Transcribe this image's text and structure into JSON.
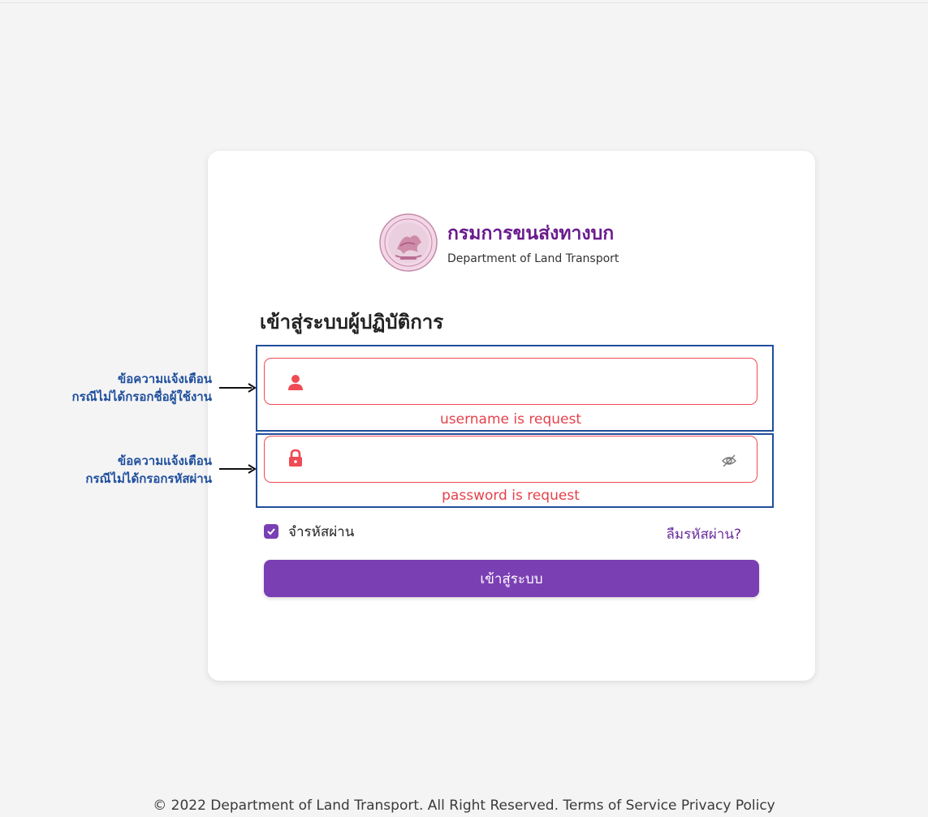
{
  "header": {
    "org_name_th": "กรมการขนส่งทางบก",
    "org_name_en": "Department of Land Transport"
  },
  "login": {
    "title": "เข้าสู่ระบบผู้ปฏิบัติการ",
    "username": {
      "value": "",
      "placeholder": "",
      "error": "username is request",
      "icon": "user-icon"
    },
    "password": {
      "value": "",
      "placeholder": "",
      "error": "password is request",
      "icon": "lock-icon",
      "toggle_icon": "eye-slash-icon"
    },
    "remember_label": "จำรหัสผ่าน",
    "remember_checked": true,
    "forgot_label": "ลืมรหัสผ่าน?",
    "submit_label": "เข้าสู่ระบบ"
  },
  "annotations": {
    "username_line1": "ข้อความแจ้งเตือน",
    "username_line2": "กรณีไม่ได้กรอกชื่อผู้ใช้งาน",
    "password_line1": "ข้อความแจ้งเตือน",
    "password_line2": "กรณีไม่ได้กรอกรหัสผ่าน"
  },
  "footer": {
    "copyright": "© 2022 Department of Land Transport. All Right Reserved.",
    "terms": "Terms of Service",
    "privacy": "Privacy Policy"
  },
  "colors": {
    "accent": "#7b3fb4",
    "brand": "#6b1b8e",
    "error": "#e5414a",
    "annotation": "#1f4f9c"
  }
}
